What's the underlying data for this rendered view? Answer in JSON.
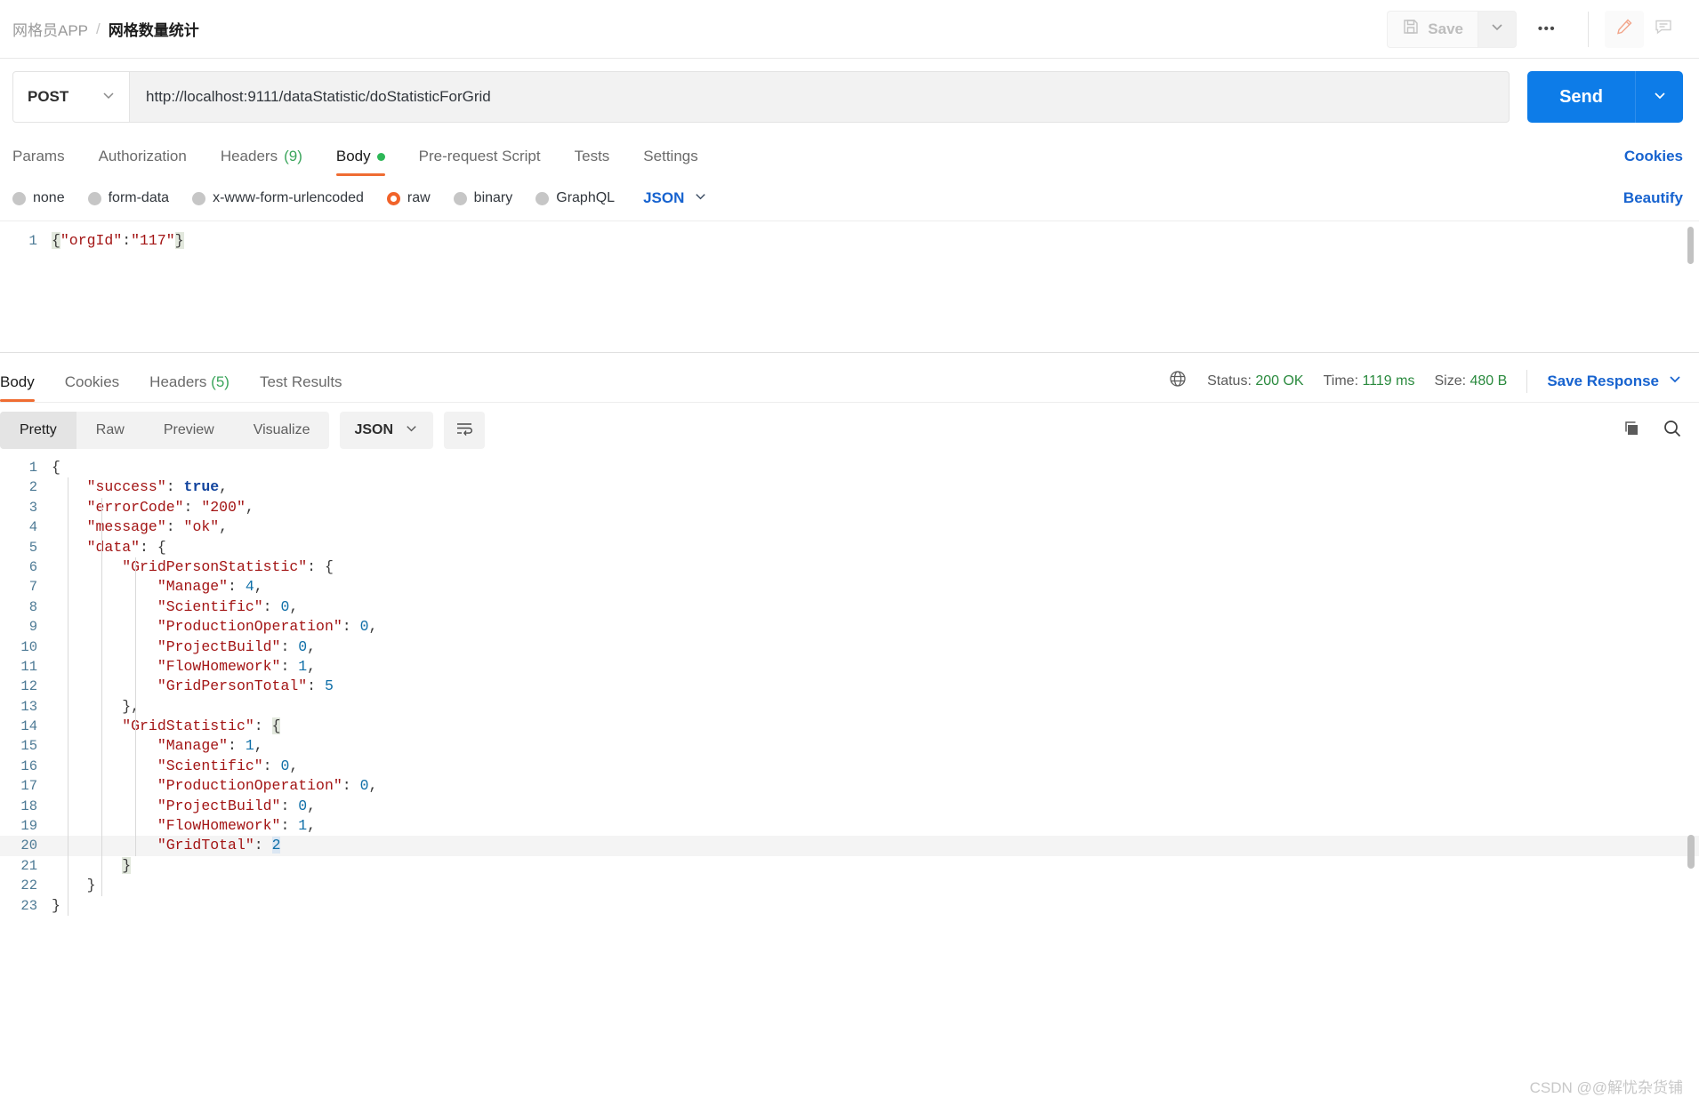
{
  "header": {
    "breadcrumb_parent": "网格员APP",
    "breadcrumb_separator": "/",
    "breadcrumb_current": "网格数量统计",
    "save_label": "Save",
    "more_label": "•••",
    "icons": {
      "save": "floppy-disk-icon",
      "save_caret": "chevron-down-icon",
      "more": "ellipsis-icon",
      "edit": "pencil-icon",
      "comment": "comment-icon"
    }
  },
  "request": {
    "method": "POST",
    "url": "http://localhost:9111/dataStatistic/doStatisticForGrid",
    "send_label": "Send",
    "tabs": [
      {
        "label": "Params",
        "count": "",
        "active": false,
        "dot": false
      },
      {
        "label": "Authorization",
        "count": "",
        "active": false,
        "dot": false
      },
      {
        "label": "Headers",
        "count": "(9)",
        "active": false,
        "dot": false
      },
      {
        "label": "Body",
        "count": "",
        "active": true,
        "dot": true
      },
      {
        "label": "Pre-request Script",
        "count": "",
        "active": false,
        "dot": false
      },
      {
        "label": "Tests",
        "count": "",
        "active": false,
        "dot": false
      },
      {
        "label": "Settings",
        "count": "",
        "active": false,
        "dot": false
      }
    ],
    "cookies_link": "Cookies",
    "body_types": [
      {
        "label": "none",
        "selected": false
      },
      {
        "label": "form-data",
        "selected": false
      },
      {
        "label": "x-www-form-urlencoded",
        "selected": false
      },
      {
        "label": "raw",
        "selected": true
      },
      {
        "label": "binary",
        "selected": false
      },
      {
        "label": "GraphQL",
        "selected": false
      }
    ],
    "body_format": "JSON",
    "beautify_label": "Beautify",
    "body_line_number": "1",
    "body_tokens": {
      "open_brace": "{",
      "key": "\"orgId\"",
      "colon": ":",
      "value": "\"117\"",
      "close_brace": "}"
    },
    "body_raw": "{\"orgId\":\"117\"}"
  },
  "response": {
    "tabs": [
      {
        "label": "Body",
        "count": "",
        "active": true
      },
      {
        "label": "Cookies",
        "count": "",
        "active": false
      },
      {
        "label": "Headers",
        "count": "(5)",
        "active": false
      },
      {
        "label": "Test Results",
        "count": "",
        "active": false
      }
    ],
    "status_label": "Status:",
    "status_value": "200 OK",
    "time_label": "Time:",
    "time_value": "1119 ms",
    "size_label": "Size:",
    "size_value": "480 B",
    "save_response_label": "Save Response",
    "view_modes": [
      {
        "label": "Pretty",
        "active": true
      },
      {
        "label": "Raw",
        "active": false
      },
      {
        "label": "Preview",
        "active": false
      },
      {
        "label": "Visualize",
        "active": false
      }
    ],
    "format": "JSON",
    "icons": {
      "globe": "globe-icon",
      "wrap": "word-wrap-icon",
      "copy": "copy-icon",
      "search": "search-icon"
    },
    "body_lines": [
      {
        "n": "1",
        "indent": 0,
        "parts": [
          {
            "t": "punc",
            "v": "{"
          }
        ]
      },
      {
        "n": "2",
        "indent": 1,
        "parts": [
          {
            "t": "key",
            "v": "\"success\""
          },
          {
            "t": "punc",
            "v": ": "
          },
          {
            "t": "bool",
            "v": "true"
          },
          {
            "t": "punc",
            "v": ","
          }
        ]
      },
      {
        "n": "3",
        "indent": 1,
        "parts": [
          {
            "t": "key",
            "v": "\"errorCode\""
          },
          {
            "t": "punc",
            "v": ": "
          },
          {
            "t": "str",
            "v": "\"200\""
          },
          {
            "t": "punc",
            "v": ","
          }
        ]
      },
      {
        "n": "4",
        "indent": 1,
        "parts": [
          {
            "t": "key",
            "v": "\"message\""
          },
          {
            "t": "punc",
            "v": ": "
          },
          {
            "t": "str",
            "v": "\"ok\""
          },
          {
            "t": "punc",
            "v": ","
          }
        ]
      },
      {
        "n": "5",
        "indent": 1,
        "parts": [
          {
            "t": "key",
            "v": "\"data\""
          },
          {
            "t": "punc",
            "v": ": {"
          }
        ]
      },
      {
        "n": "6",
        "indent": 2,
        "parts": [
          {
            "t": "key",
            "v": "\"GridPersonStatistic\""
          },
          {
            "t": "punc",
            "v": ": {"
          }
        ]
      },
      {
        "n": "7",
        "indent": 3,
        "parts": [
          {
            "t": "key",
            "v": "\"Manage\""
          },
          {
            "t": "punc",
            "v": ": "
          },
          {
            "t": "num",
            "v": "4"
          },
          {
            "t": "punc",
            "v": ","
          }
        ]
      },
      {
        "n": "8",
        "indent": 3,
        "parts": [
          {
            "t": "key",
            "v": "\"Scientific\""
          },
          {
            "t": "punc",
            "v": ": "
          },
          {
            "t": "num",
            "v": "0"
          },
          {
            "t": "punc",
            "v": ","
          }
        ]
      },
      {
        "n": "9",
        "indent": 3,
        "parts": [
          {
            "t": "key",
            "v": "\"ProductionOperation\""
          },
          {
            "t": "punc",
            "v": ": "
          },
          {
            "t": "num",
            "v": "0"
          },
          {
            "t": "punc",
            "v": ","
          }
        ]
      },
      {
        "n": "10",
        "indent": 3,
        "parts": [
          {
            "t": "key",
            "v": "\"ProjectBuild\""
          },
          {
            "t": "punc",
            "v": ": "
          },
          {
            "t": "num",
            "v": "0"
          },
          {
            "t": "punc",
            "v": ","
          }
        ]
      },
      {
        "n": "11",
        "indent": 3,
        "parts": [
          {
            "t": "key",
            "v": "\"FlowHomework\""
          },
          {
            "t": "punc",
            "v": ": "
          },
          {
            "t": "num",
            "v": "1"
          },
          {
            "t": "punc",
            "v": ","
          }
        ]
      },
      {
        "n": "12",
        "indent": 3,
        "parts": [
          {
            "t": "key",
            "v": "\"GridPersonTotal\""
          },
          {
            "t": "punc",
            "v": ": "
          },
          {
            "t": "num",
            "v": "5"
          }
        ]
      },
      {
        "n": "13",
        "indent": 2,
        "parts": [
          {
            "t": "punc",
            "v": "},"
          }
        ]
      },
      {
        "n": "14",
        "indent": 2,
        "parts": [
          {
            "t": "key",
            "v": "\"GridStatistic\""
          },
          {
            "t": "punc",
            "v": ": "
          },
          {
            "t": "brace-hi",
            "v": "{"
          }
        ]
      },
      {
        "n": "15",
        "indent": 3,
        "parts": [
          {
            "t": "key",
            "v": "\"Manage\""
          },
          {
            "t": "punc",
            "v": ": "
          },
          {
            "t": "num",
            "v": "1"
          },
          {
            "t": "punc",
            "v": ","
          }
        ]
      },
      {
        "n": "16",
        "indent": 3,
        "parts": [
          {
            "t": "key",
            "v": "\"Scientific\""
          },
          {
            "t": "punc",
            "v": ": "
          },
          {
            "t": "num",
            "v": "0"
          },
          {
            "t": "punc",
            "v": ","
          }
        ]
      },
      {
        "n": "17",
        "indent": 3,
        "parts": [
          {
            "t": "key",
            "v": "\"ProductionOperation\""
          },
          {
            "t": "punc",
            "v": ": "
          },
          {
            "t": "num",
            "v": "0"
          },
          {
            "t": "punc",
            "v": ","
          }
        ]
      },
      {
        "n": "18",
        "indent": 3,
        "parts": [
          {
            "t": "key",
            "v": "\"ProjectBuild\""
          },
          {
            "t": "punc",
            "v": ": "
          },
          {
            "t": "num",
            "v": "0"
          },
          {
            "t": "punc",
            "v": ","
          }
        ]
      },
      {
        "n": "19",
        "indent": 3,
        "parts": [
          {
            "t": "key",
            "v": "\"FlowHomework\""
          },
          {
            "t": "punc",
            "v": ": "
          },
          {
            "t": "num",
            "v": "1"
          },
          {
            "t": "punc",
            "v": ","
          }
        ]
      },
      {
        "n": "20",
        "indent": 3,
        "active": true,
        "parts": [
          {
            "t": "key",
            "v": "\"GridTotal\""
          },
          {
            "t": "punc",
            "v": ": "
          },
          {
            "t": "num-sel",
            "v": "2"
          }
        ]
      },
      {
        "n": "21",
        "indent": 2,
        "parts": [
          {
            "t": "brace-hi",
            "v": "}"
          }
        ]
      },
      {
        "n": "22",
        "indent": 1,
        "parts": [
          {
            "t": "punc",
            "v": "}"
          }
        ]
      },
      {
        "n": "23",
        "indent": 0,
        "parts": [
          {
            "t": "punc",
            "v": "}"
          }
        ]
      }
    ]
  },
  "watermark": "CSDN @@解忧杂货铺",
  "colors": {
    "accent_orange": "#ef6c32",
    "link_blue": "#1763cf",
    "send_blue": "#0d7ce8",
    "status_green": "#2a8a3e",
    "radio_selected": "#f1632a"
  }
}
